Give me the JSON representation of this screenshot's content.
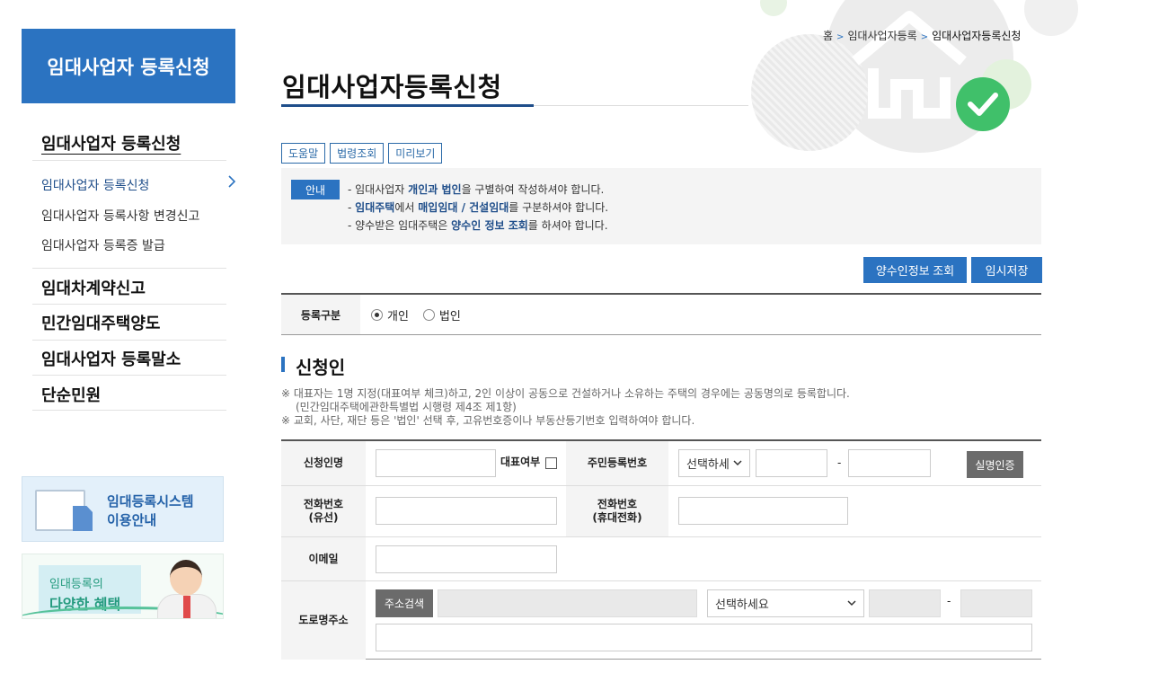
{
  "sidebar": {
    "header": "임대사업자 등록신청",
    "section_title": "임대사업자 등록신청",
    "sub_items": [
      {
        "label": "임대사업자 등록신청"
      },
      {
        "label": "임대사업자 등록사항 변경신고"
      },
      {
        "label": "임대사업자 등록증 발급"
      }
    ],
    "main_items": [
      {
        "label": "임대차계약신고"
      },
      {
        "label": "민간임대주택양도"
      },
      {
        "label": "임대사업자 등록말소"
      },
      {
        "label": "단순민원"
      }
    ],
    "banner1": {
      "line1": "임대등록시스템",
      "line2": "이용안내"
    },
    "banner2": {
      "line1": "임대등록의",
      "line2": "다양한 혜택"
    }
  },
  "breadcrumb": [
    "홈",
    "임대사업자등록",
    "임대사업자등록신청"
  ],
  "page_title": "임대사업자등록신청",
  "tool_buttons": [
    "도움말",
    "법령조회",
    "미리보기"
  ],
  "info": {
    "tag": "안내",
    "line1": {
      "a": "- 임대사업자 ",
      "b": "개인과 법인",
      "c": "을 구별하여 작성하셔야 합니다."
    },
    "line2": {
      "a": "- ",
      "b": "임대주택",
      "c": "에서 ",
      "d": "매입임대 / 건설임대",
      "e": "를 구분하셔야 합니다."
    },
    "line3": {
      "a": "- 양수받은 임대주택은 ",
      "b": "양수인 정보 조회",
      "c": "를 하셔야 합니다."
    }
  },
  "actions": {
    "lookup": "양수인정보 조회",
    "save": "임시저장"
  },
  "reg_type": {
    "label": "등록구분",
    "options": [
      "개인",
      "법인"
    ],
    "selected": "개인"
  },
  "section": {
    "title": "신청인",
    "note1": "※ 대표자는 1명 지정(대표여부 체크)하고, 2인 이상이 공동으로 건설하거나 소유하는 주택의 경우에는 공동명의로 등록합니다.",
    "note1b": "(민간임대주택에관한특별법 시행령 제4조 제1항)",
    "note2": "※ 교회, 사단, 재단 등은 '법인' 선택 후, 고유번호증이나 부동산등기번호 입력하여야 합니다."
  },
  "form": {
    "applicant": "신청인명",
    "representative": "대표여부",
    "resident_no": "주민등록번호",
    "resident_select": "선택하세",
    "dash": "-",
    "verify": "실명인증",
    "phone_wired_1": "전화번호",
    "phone_wired_2": "(유선)",
    "phone_mobile_1": "전화번호",
    "phone_mobile_2": "(휴대전화)",
    "email": "이메일",
    "road_address": "도로명주소",
    "addr_search": "주소검색",
    "addr_select": "선택하세요",
    "addr_dash": "-"
  },
  "colors": {
    "primary": "#2b73c1",
    "dark_blue": "#1f4e8a",
    "grey_btn": "#6b6b6b"
  }
}
